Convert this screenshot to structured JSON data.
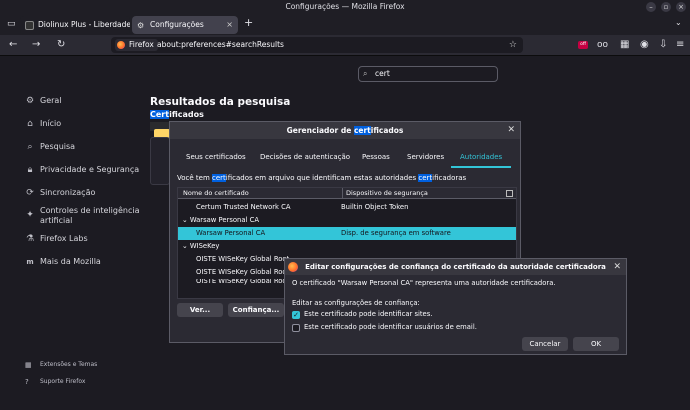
{
  "window": {
    "title": "Configurações — Mozilla Firefox"
  },
  "tabs": [
    {
      "label": "Diolinux Plus - Liberdade"
    },
    {
      "label": "Configurações"
    }
  ],
  "navbar": {
    "identity_label": "Firefox",
    "url": "about:preferences#searchResults",
    "ext_badge": "off"
  },
  "sidebar": {
    "items": [
      {
        "label": "Geral",
        "icon": "gear-icon"
      },
      {
        "label": "Início",
        "icon": "home-icon"
      },
      {
        "label": "Pesquisa",
        "icon": "search-icon"
      },
      {
        "label": "Privacidade e Segurança",
        "icon": "lock-icon"
      },
      {
        "label": "Sincronização",
        "icon": "sync-icon"
      },
      {
        "label": "Controles de inteligência artificial",
        "icon": "sparkle-icon"
      },
      {
        "label": "Firefox Labs",
        "icon": "flask-icon"
      },
      {
        "label": "Mais da Mozilla",
        "icon": "mozilla-icon"
      }
    ],
    "footer": [
      {
        "label": "Extensões e Temas"
      },
      {
        "label": "Suporte Firefox"
      }
    ]
  },
  "search": {
    "value": "cert"
  },
  "results": {
    "title": "Resultados da pesquisa",
    "subtitle_hl": "Cert",
    "subtitle_rest": "ificados"
  },
  "cert_manager": {
    "title_pre": "Gerenciador de ",
    "title_hl": "cert",
    "title_post": "ificados",
    "tabs": [
      "Seus certificados",
      "Decisões de autenticação",
      "Pessoas",
      "Servidores",
      "Autoridades"
    ],
    "desc_pre": "Você tem ",
    "desc_hl1": "cert",
    "desc_mid": "ificados em arquivo que identificam estas autoridades ",
    "desc_hl2": "cert",
    "desc_post": "ificadoras",
    "columns": [
      "Nome do certificado",
      "Dispositivo de segurança"
    ],
    "rows": [
      {
        "name": "Certum Trusted Network CA",
        "device": "Builtin Object Token"
      },
      {
        "name": "Warsaw Personal CA",
        "device": ""
      },
      {
        "name": "Warsaw Personal CA",
        "device": "Disp. de segurança em software"
      },
      {
        "name": "WISeKey",
        "device": ""
      },
      {
        "name": "OISTE WISeKey Global Root",
        "device": ""
      },
      {
        "name": "OISTE WISeKey Global Root",
        "device": ""
      },
      {
        "name": "OISTE WISeKey Global Root",
        "device": ""
      }
    ],
    "buttons": {
      "view": "Ver...",
      "trust": "Confiança..."
    }
  },
  "trust_dialog": {
    "title": "Editar configurações de confiança do certificado da autoridade certificadora",
    "message": "O certificado \"Warsaw Personal CA\" representa uma autoridade certificadora.",
    "prompt": "Editar as configurações de confiança:",
    "options": [
      {
        "label": "Este certificado pode identificar sites.",
        "checked": true
      },
      {
        "label": "Este certificado pode identificar usuários de email.",
        "checked": false
      }
    ],
    "cancel": "Cancelar",
    "ok": "OK"
  }
}
